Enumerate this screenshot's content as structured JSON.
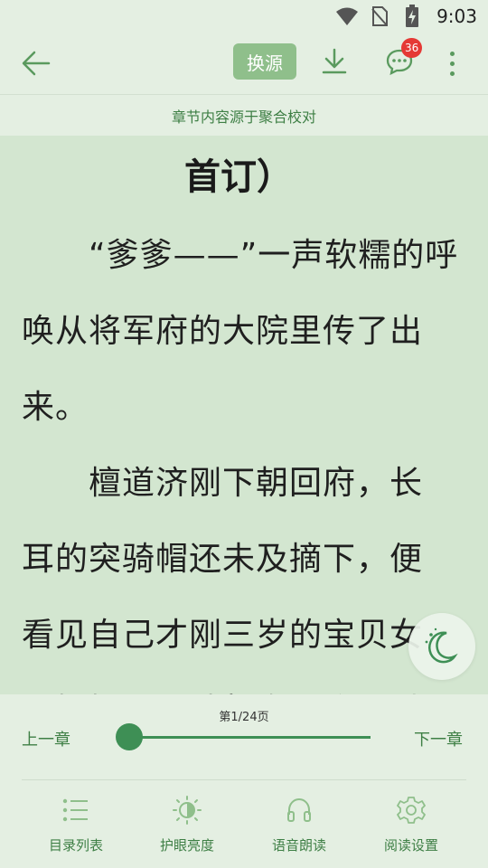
{
  "status_bar": {
    "time": "9:03",
    "icons": [
      "wifi-icon",
      "no-sim-icon",
      "battery-charging-icon"
    ]
  },
  "toolbar": {
    "back_icon": "arrow-left-icon",
    "source_label": "换源",
    "download_icon": "download-icon",
    "comment_icon": "comment-icon",
    "comment_count": "36",
    "more_icon": "more-vert-icon"
  },
  "source_notice": "章节内容源于聚合校对",
  "reader": {
    "chapter_title": "首订）",
    "lines": [
      "　　“爹爹——”一声软糯的呼",
      "唤从将军府的大院里传了出",
      "来。",
      "　　檀道济刚下朝回府，长",
      "耳的突骑帽还未及摘下，便",
      "看见自己才刚三岁的宝贝女",
      "儿摇摇晃晃地朝自己跑了过"
    ]
  },
  "night_mode_icon": "moon-stars-icon",
  "bottom_panel": {
    "page_indicator": "第1/24页",
    "prev_chapter": "上一章",
    "next_chapter": "下一章",
    "progress": 0.0,
    "nav": [
      {
        "label": "目录列表",
        "icon": "list-icon"
      },
      {
        "label": "护眼亮度",
        "icon": "brightness-icon"
      },
      {
        "label": "语音朗读",
        "icon": "headphones-icon"
      },
      {
        "label": "阅读设置",
        "icon": "gear-icon"
      }
    ]
  },
  "colors": {
    "accent": "#3e8f55",
    "reader_bg": "#d3e6d0",
    "panel_bg": "#e4efe2",
    "badge": "#e53935"
  }
}
